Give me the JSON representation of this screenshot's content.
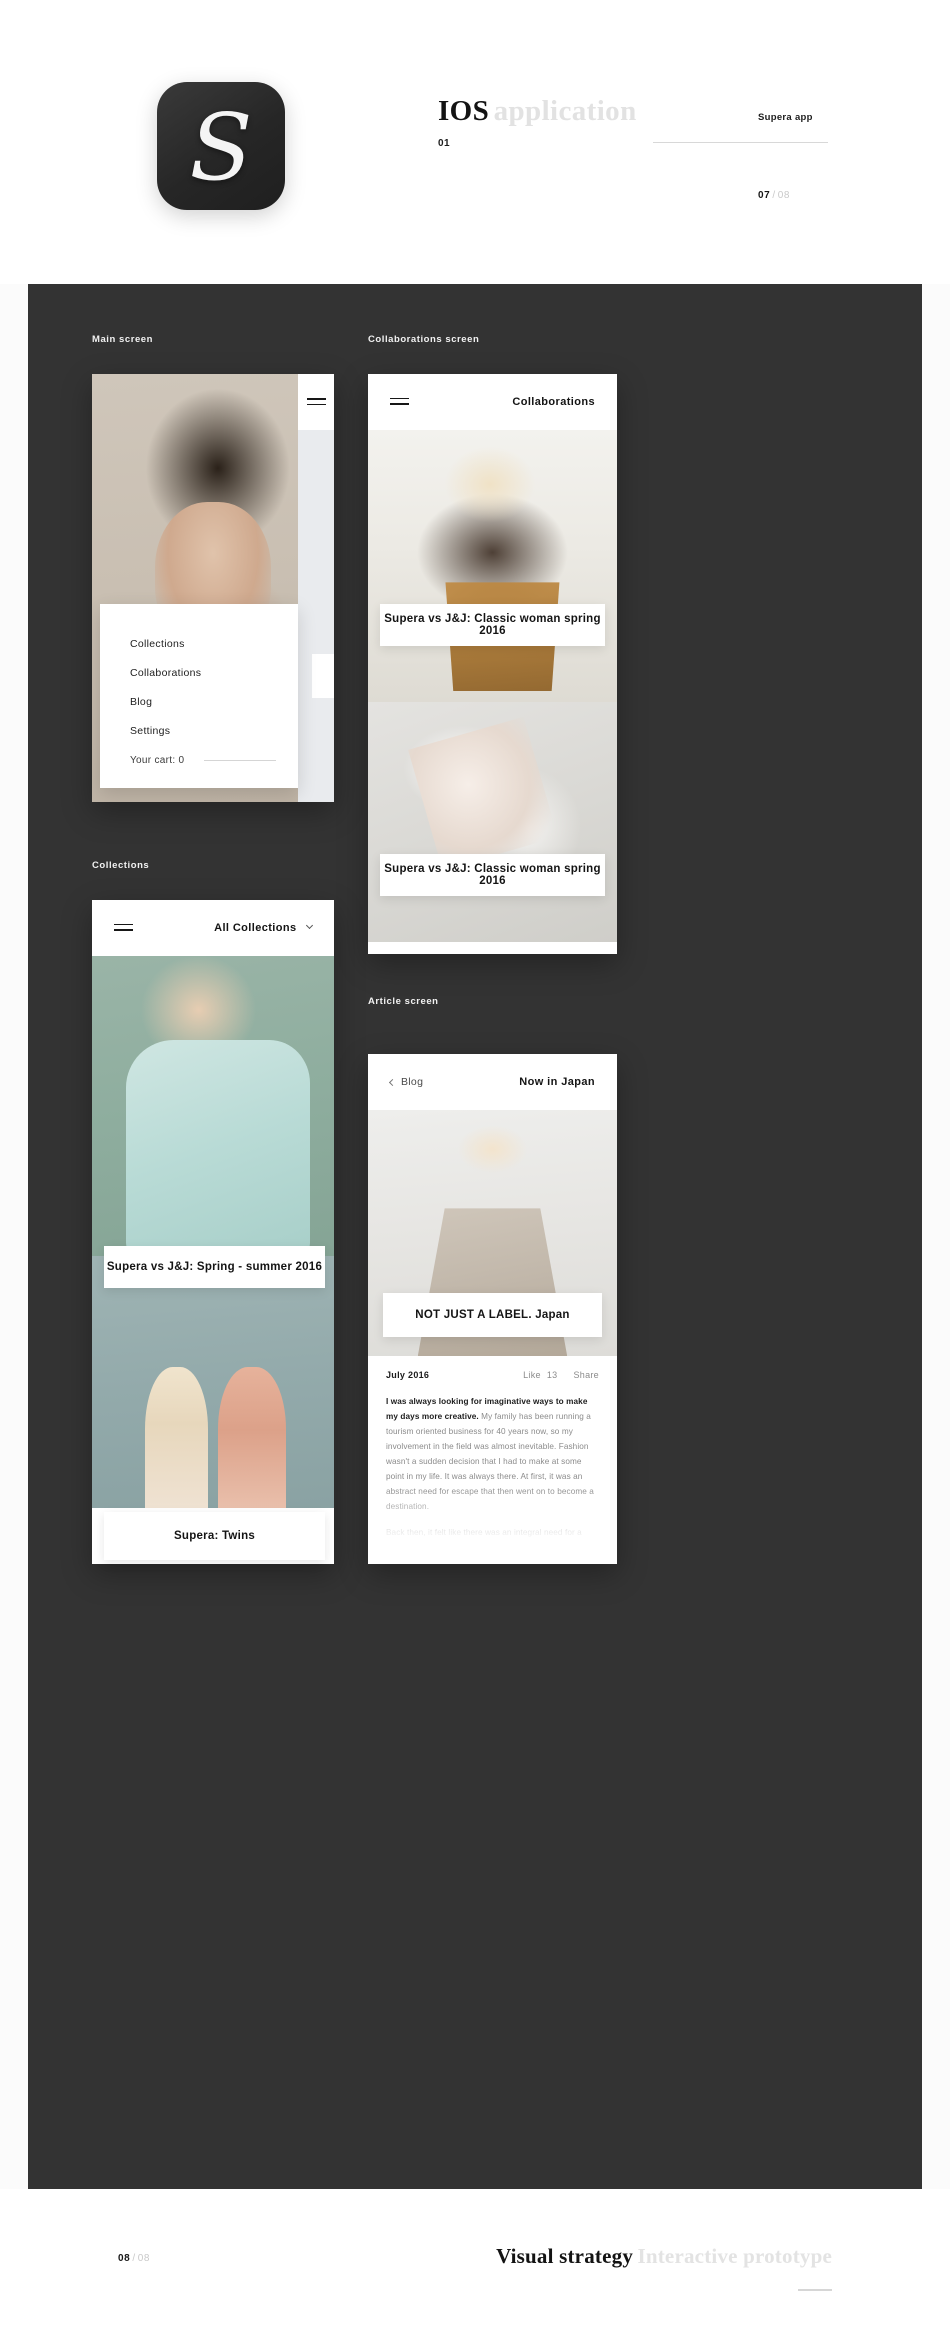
{
  "header": {
    "app_icon_letter": "S",
    "title_strong": "IOS",
    "title_weak": "application",
    "number": "01",
    "right_label": "Supera app",
    "pager_current": "07",
    "pager_sep": "/",
    "pager_total": "08"
  },
  "board": {
    "labels": {
      "main_screen": "Main screen",
      "collaborations_screen": "Collaborations screen",
      "collections": "Collections",
      "article_screen": "Article screen"
    },
    "main_screen": {
      "menu_icon": "hamburger-icon",
      "menu_items": [
        {
          "label": "Collections"
        },
        {
          "label": "Collaborations"
        },
        {
          "label": "Blog"
        },
        {
          "label": "Settings"
        }
      ],
      "cart_label": "Your cart: 0"
    },
    "collaborations_screen": {
      "menu_icon": "hamburger-icon",
      "title": "Collaborations",
      "cards": [
        {
          "caption": "Supera vs J&J: Classic woman spring 2016"
        },
        {
          "caption": "Supera vs J&J: Classic woman spring 2016"
        }
      ]
    },
    "collections_screen": {
      "menu_icon": "hamburger-icon",
      "filter_label": "All Collections",
      "filter_icon": "chevron-down-icon",
      "cards": [
        {
          "caption": "Supera vs J&J: Spring - summer 2016"
        },
        {
          "caption": "Supera: Twins"
        }
      ]
    },
    "article_screen": {
      "back_icon": "chevron-left-icon",
      "back_label": "Blog",
      "title": "Now in Japan",
      "hero_caption": "NOT JUST A LABEL. Japan",
      "date": "July 2016",
      "like_label": "Like",
      "like_count": "13",
      "share_label": "Share",
      "paragraph_1_lead": "I was always looking for imaginative ways to make my days more creative.",
      "paragraph_1_rest": " My family has been running a tourism oriented business for 40 years now, so my involvement in the field was almost inevitable. Fashion wasn't a sudden decision that I had to make at some point in my life. It was always there. At first, it was an abstract need for escape that then went on to become a destination.",
      "paragraph_2": "Back then, it felt like there was an integral need for a jump to another platform which was more extrovert and interactive. The transition was more challenging than threatening. After twenty-two Supera collections, I have come to realize that this transition was a kairotic moment for me, or that was when I reformed and developed myself as a desi"
    }
  },
  "footer": {
    "pager_current": "08",
    "pager_sep": "/",
    "pager_total": "08",
    "title_strong": "Visual strategy",
    "title_weak": "Interactive prototype"
  },
  "colors": {
    "board_bg": "#333333",
    "page_bg": "#fbfbfb",
    "ink": "#141414",
    "muted": "#c9c9c9"
  }
}
